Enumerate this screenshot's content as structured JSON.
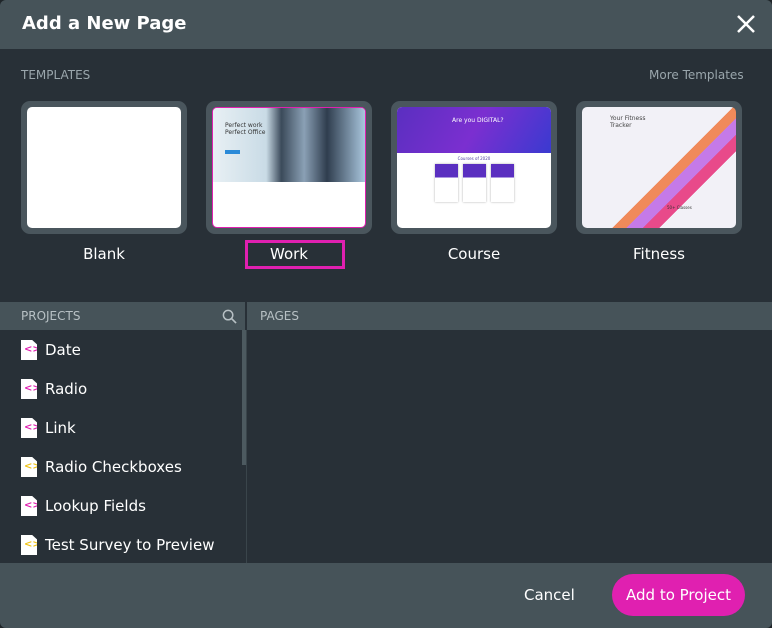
{
  "dialog": {
    "title": "Add a New Page",
    "close_icon": "close-icon"
  },
  "templates": {
    "label": "TEMPLATES",
    "more": "More Templates",
    "items": [
      {
        "label": "Blank"
      },
      {
        "label": "Work",
        "selected": true
      },
      {
        "label": "Course"
      },
      {
        "label": "Fitness"
      }
    ],
    "work_thumb": {
      "headline1": "Perfect work",
      "headline2": "Perfect Office"
    },
    "course_thumb": {
      "headline": "Are you DIGITAL?",
      "section": "Courses of 2020"
    },
    "fitness_thumb": {
      "headline1": "Your Fitness",
      "headline2": "Tracker",
      "classes": "50+ Classes"
    }
  },
  "projects": {
    "label": "PROJECTS",
    "search_icon": "search-icon",
    "items": [
      {
        "label": "Date",
        "color": "#e020b0"
      },
      {
        "label": "Radio",
        "color": "#e020b0"
      },
      {
        "label": "Link",
        "color": "#e020b0"
      },
      {
        "label": "Radio Checkboxes",
        "color": "#f0c419"
      },
      {
        "label": "Lookup Fields",
        "color": "#e020b0"
      },
      {
        "label": "Test Survey to Preview",
        "color": "#f0c419"
      }
    ]
  },
  "pages": {
    "label": "PAGES"
  },
  "footer": {
    "cancel": "Cancel",
    "add": "Add to Project"
  },
  "colors": {
    "accent": "#e020b0"
  }
}
